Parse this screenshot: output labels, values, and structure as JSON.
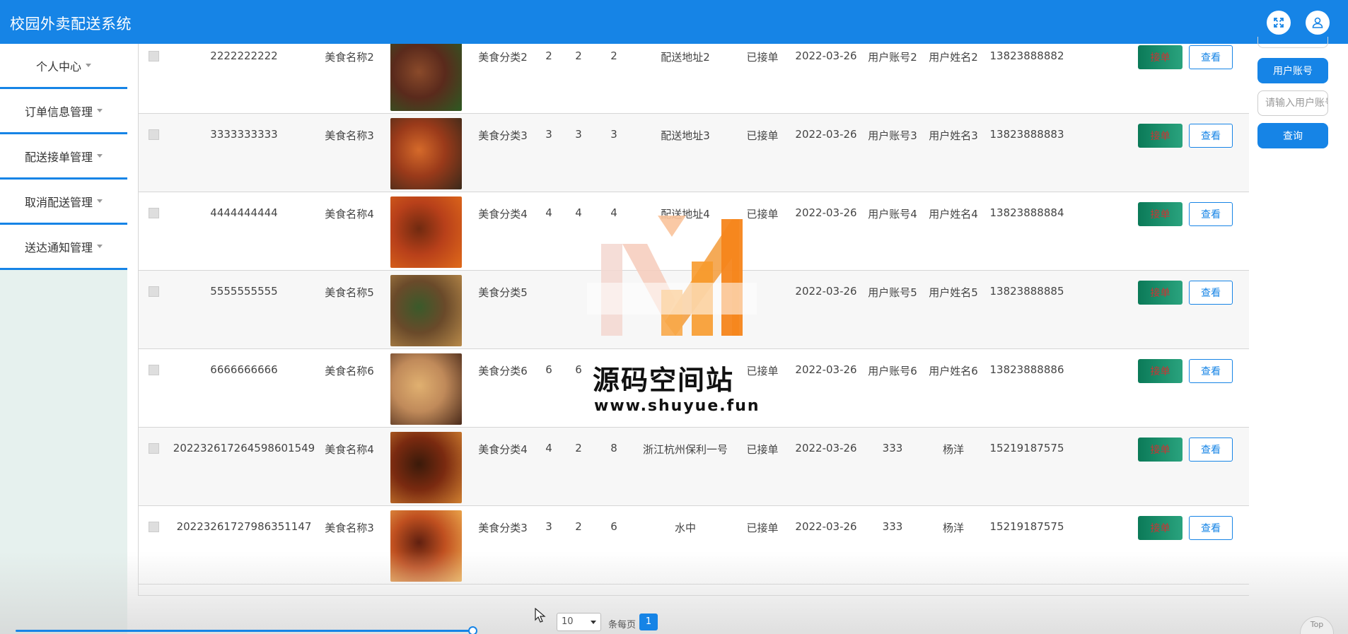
{
  "app": {
    "title": "校园外卖配送系统"
  },
  "header_icons": {
    "fullscreen": "fullscreen-icon",
    "user": "user-icon"
  },
  "sidebar": {
    "items": [
      {
        "label": "个人中心"
      },
      {
        "label": "订单信息管理"
      },
      {
        "label": "配送接单管理"
      },
      {
        "label": "取消配送管理"
      },
      {
        "label": "送达通知管理"
      }
    ]
  },
  "search_panel": {
    "field_button": "用户账号",
    "placeholder": "请输入用户账号",
    "query_button": "查询"
  },
  "table": {
    "rows": [
      {
        "order_no": "2222222222",
        "food_name": "美食名称2",
        "food_type": "美食分类2",
        "a": "2",
        "b": "2",
        "c": "2",
        "address": "配送地址2",
        "status": "已接单",
        "date": "2022-03-26",
        "account": "用户账号2",
        "user_name": "用户姓名2",
        "phone": "13823888882"
      },
      {
        "order_no": "3333333333",
        "food_name": "美食名称3",
        "food_type": "美食分类3",
        "a": "3",
        "b": "3",
        "c": "3",
        "address": "配送地址3",
        "status": "已接单",
        "date": "2022-03-26",
        "account": "用户账号3",
        "user_name": "用户姓名3",
        "phone": "13823888883"
      },
      {
        "order_no": "4444444444",
        "food_name": "美食名称4",
        "food_type": "美食分类4",
        "a": "4",
        "b": "4",
        "c": "4",
        "address": "配送地址4",
        "status": "已接单",
        "date": "2022-03-26",
        "account": "用户账号4",
        "user_name": "用户姓名4",
        "phone": "13823888884"
      },
      {
        "order_no": "5555555555",
        "food_name": "美食名称5",
        "food_type": "美食分类5",
        "a": "",
        "b": "",
        "c": "",
        "address": "",
        "status": "",
        "date": "2022-03-26",
        "account": "用户账号5",
        "user_name": "用户姓名5",
        "phone": "13823888885"
      },
      {
        "order_no": "6666666666",
        "food_name": "美食名称6",
        "food_type": "美食分类6",
        "a": "6",
        "b": "6",
        "c": "",
        "address": "",
        "status": "已接单",
        "date": "2022-03-26",
        "account": "用户账号6",
        "user_name": "用户姓名6",
        "phone": "13823888886"
      },
      {
        "order_no": "20223261726459860154​9",
        "food_name": "美食名称4",
        "food_type": "美食分类4",
        "a": "4",
        "b": "2",
        "c": "8",
        "address": "浙江杭州保利一号",
        "status": "已接单",
        "date": "2022-03-26",
        "account": "333",
        "user_name": "杨洋",
        "phone": "15219187575"
      },
      {
        "order_no": "2022326172798635114​7",
        "food_name": "美食名称3",
        "food_type": "美食分类3",
        "a": "3",
        "b": "2",
        "c": "6",
        "address": "水中",
        "status": "已接单",
        "date": "2022-03-26",
        "account": "333",
        "user_name": "杨洋",
        "phone": "15219187575"
      }
    ],
    "take_button": "接单",
    "view_button": "查看"
  },
  "pagination": {
    "page_size": "10",
    "per_page_label": "条每页",
    "current_page": "1"
  },
  "top_button": "Top",
  "watermark": {
    "name": "源码空间站",
    "url": "www.shuyue.fun"
  },
  "colors": {
    "primary": "#1684e6",
    "take_btn": "#0b7a58",
    "sidebar_bg": "#e6f1ee"
  }
}
